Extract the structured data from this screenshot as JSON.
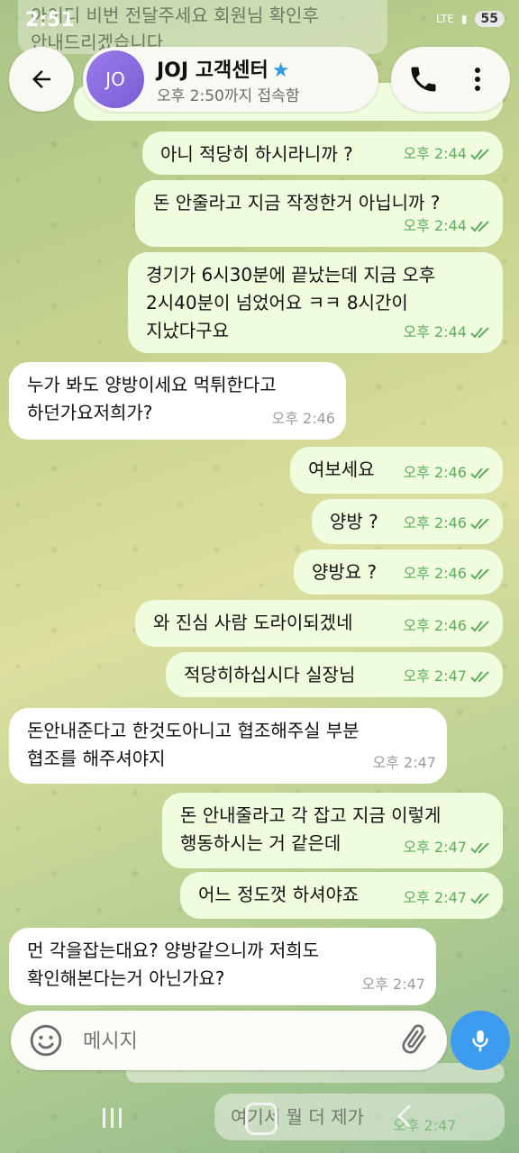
{
  "status_bar": {
    "time": "2:51",
    "battery": "55",
    "network": "LTE"
  },
  "header": {
    "avatar_initials": "JO",
    "title": "JOJ 고객센터",
    "subtitle": "오후 2:50까지 접속함"
  },
  "notification_preview": "아이디 비번 전달주세요 회원님 확인후\n안내드리겠습니다",
  "messages": [
    {
      "dir": "out",
      "text": "",
      "time": "오후 2:44"
    },
    {
      "dir": "out",
      "text": "아니 적당히 하시라니까 ?",
      "time": "오후 2:44"
    },
    {
      "dir": "out",
      "text": "돈 안줄라고 지금 작정한거 아닙니까 ?",
      "time": "오후 2:44"
    },
    {
      "dir": "out",
      "text": "경기가 6시30분에 끝났는데 지금 오후\n2시40분이 넘었어요 ㅋㅋ 8시간이\n지났다구요",
      "time": "오후 2:44"
    },
    {
      "dir": "in",
      "text": "누가 봐도 양방이세요 먹튀한다고\n하던가요저희가?",
      "time": "오후 2:46"
    },
    {
      "dir": "out",
      "text": "여보세요",
      "time": "오후 2:46"
    },
    {
      "dir": "out",
      "text": "양방 ?",
      "time": "오후 2:46"
    },
    {
      "dir": "out",
      "text": "양방요 ?",
      "time": "오후 2:46"
    },
    {
      "dir": "out",
      "text": "와 진심 사람 도라이되겠네",
      "time": "오후 2:46"
    },
    {
      "dir": "out",
      "text": "적당히하십시다 실장님",
      "time": "오후 2:47"
    },
    {
      "dir": "in",
      "text": "돈안내준다고 한것도아니고 협조해주실 부분\n협조를 해주셔야지",
      "time": "오후 2:47"
    },
    {
      "dir": "out",
      "text": "돈 안내줄라고 각 잡고 지금 이렇게\n행동하시는 거 같은데",
      "time": "오후 2:47"
    },
    {
      "dir": "out",
      "text": "어느 정도껏 하셔야죠",
      "time": "오후 2:47"
    },
    {
      "dir": "in",
      "text": "먼 각을잡는대요? 양방같으니까 저희도\n확인해본다는거 아닌가요?",
      "time": "오후 2:47"
    }
  ],
  "input": {
    "placeholder": "메시지"
  },
  "behind_nav": {
    "text": "여기서 뭘 더 제가",
    "time": "오후 2:47"
  },
  "colors": {
    "outgoing_bubble": "#effdde",
    "incoming_bubble": "#ffffff",
    "accent": "#3d9cf0",
    "tick": "#5fab5d"
  },
  "icons": [
    "back-arrow-icon",
    "phone-icon",
    "more-vert-icon",
    "emoji-icon",
    "attach-icon",
    "mic-icon",
    "star-icon",
    "double-check-icon"
  ]
}
